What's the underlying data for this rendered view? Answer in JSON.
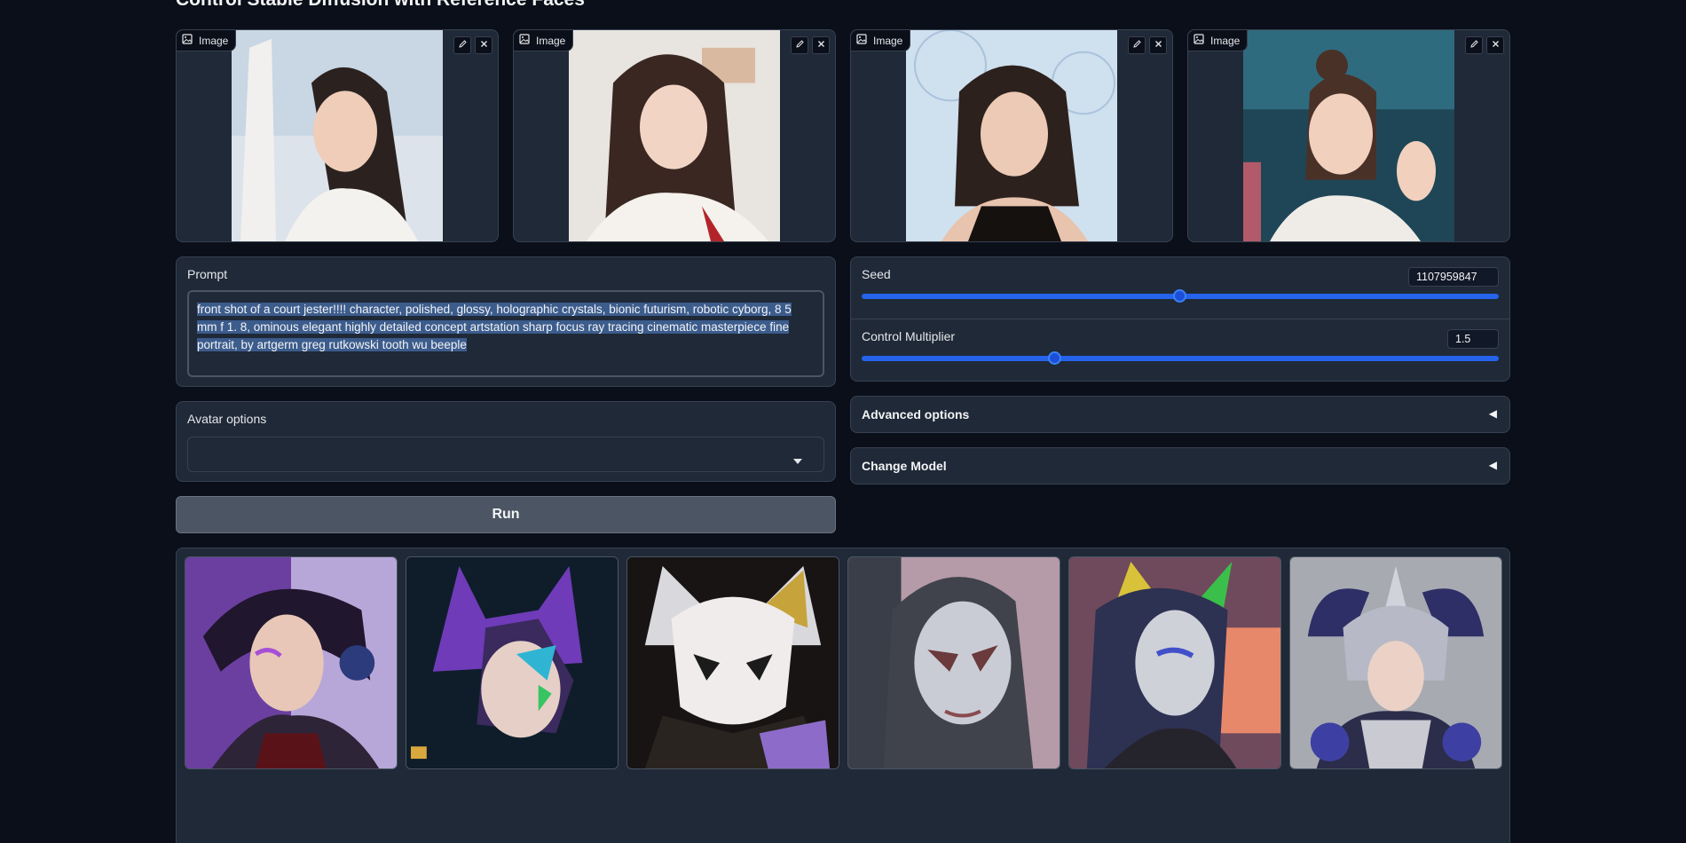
{
  "page": {
    "title": "Control Stable Diffusion with Reference Faces"
  },
  "reference_images": [
    {
      "label": "Image",
      "edit_icon": "pencil-icon",
      "clear_icon": "close-icon"
    },
    {
      "label": "Image",
      "edit_icon": "pencil-icon",
      "clear_icon": "close-icon"
    },
    {
      "label": "Image",
      "edit_icon": "pencil-icon",
      "clear_icon": "close-icon"
    },
    {
      "label": "Image",
      "edit_icon": "pencil-icon",
      "clear_icon": "close-icon"
    }
  ],
  "prompt": {
    "label": "Prompt",
    "value": "front shot of a court jester!!!! character, polished, glossy, holographic crystals, bionic futurism, robotic cyborg, 8 5 mm f 1. 8, ominous elegant highly detailed concept artstation sharp focus ray tracing cinematic masterpiece fine portrait, by artgerm greg rutkowski tooth wu beeple"
  },
  "seed": {
    "label": "Seed",
    "value": "1107959847",
    "slider_fraction": 0.516
  },
  "control_multiplier": {
    "label": "Control Multiplier",
    "value": "1.5",
    "slider_fraction": 0.3
  },
  "avatar_options": {
    "label": "Avatar options",
    "selected": "",
    "icon": "caret-down-icon"
  },
  "advanced_options": {
    "label": "Advanced options",
    "arrow": "◀"
  },
  "change_model": {
    "label": "Change Model",
    "arrow": "◀"
  },
  "run_button": {
    "label": "Run"
  },
  "colors": {
    "background": "#0b0f19",
    "panel": "#1f2937",
    "border": "#374151",
    "accent": "#2563eb",
    "selection": "#3c5c8c"
  }
}
